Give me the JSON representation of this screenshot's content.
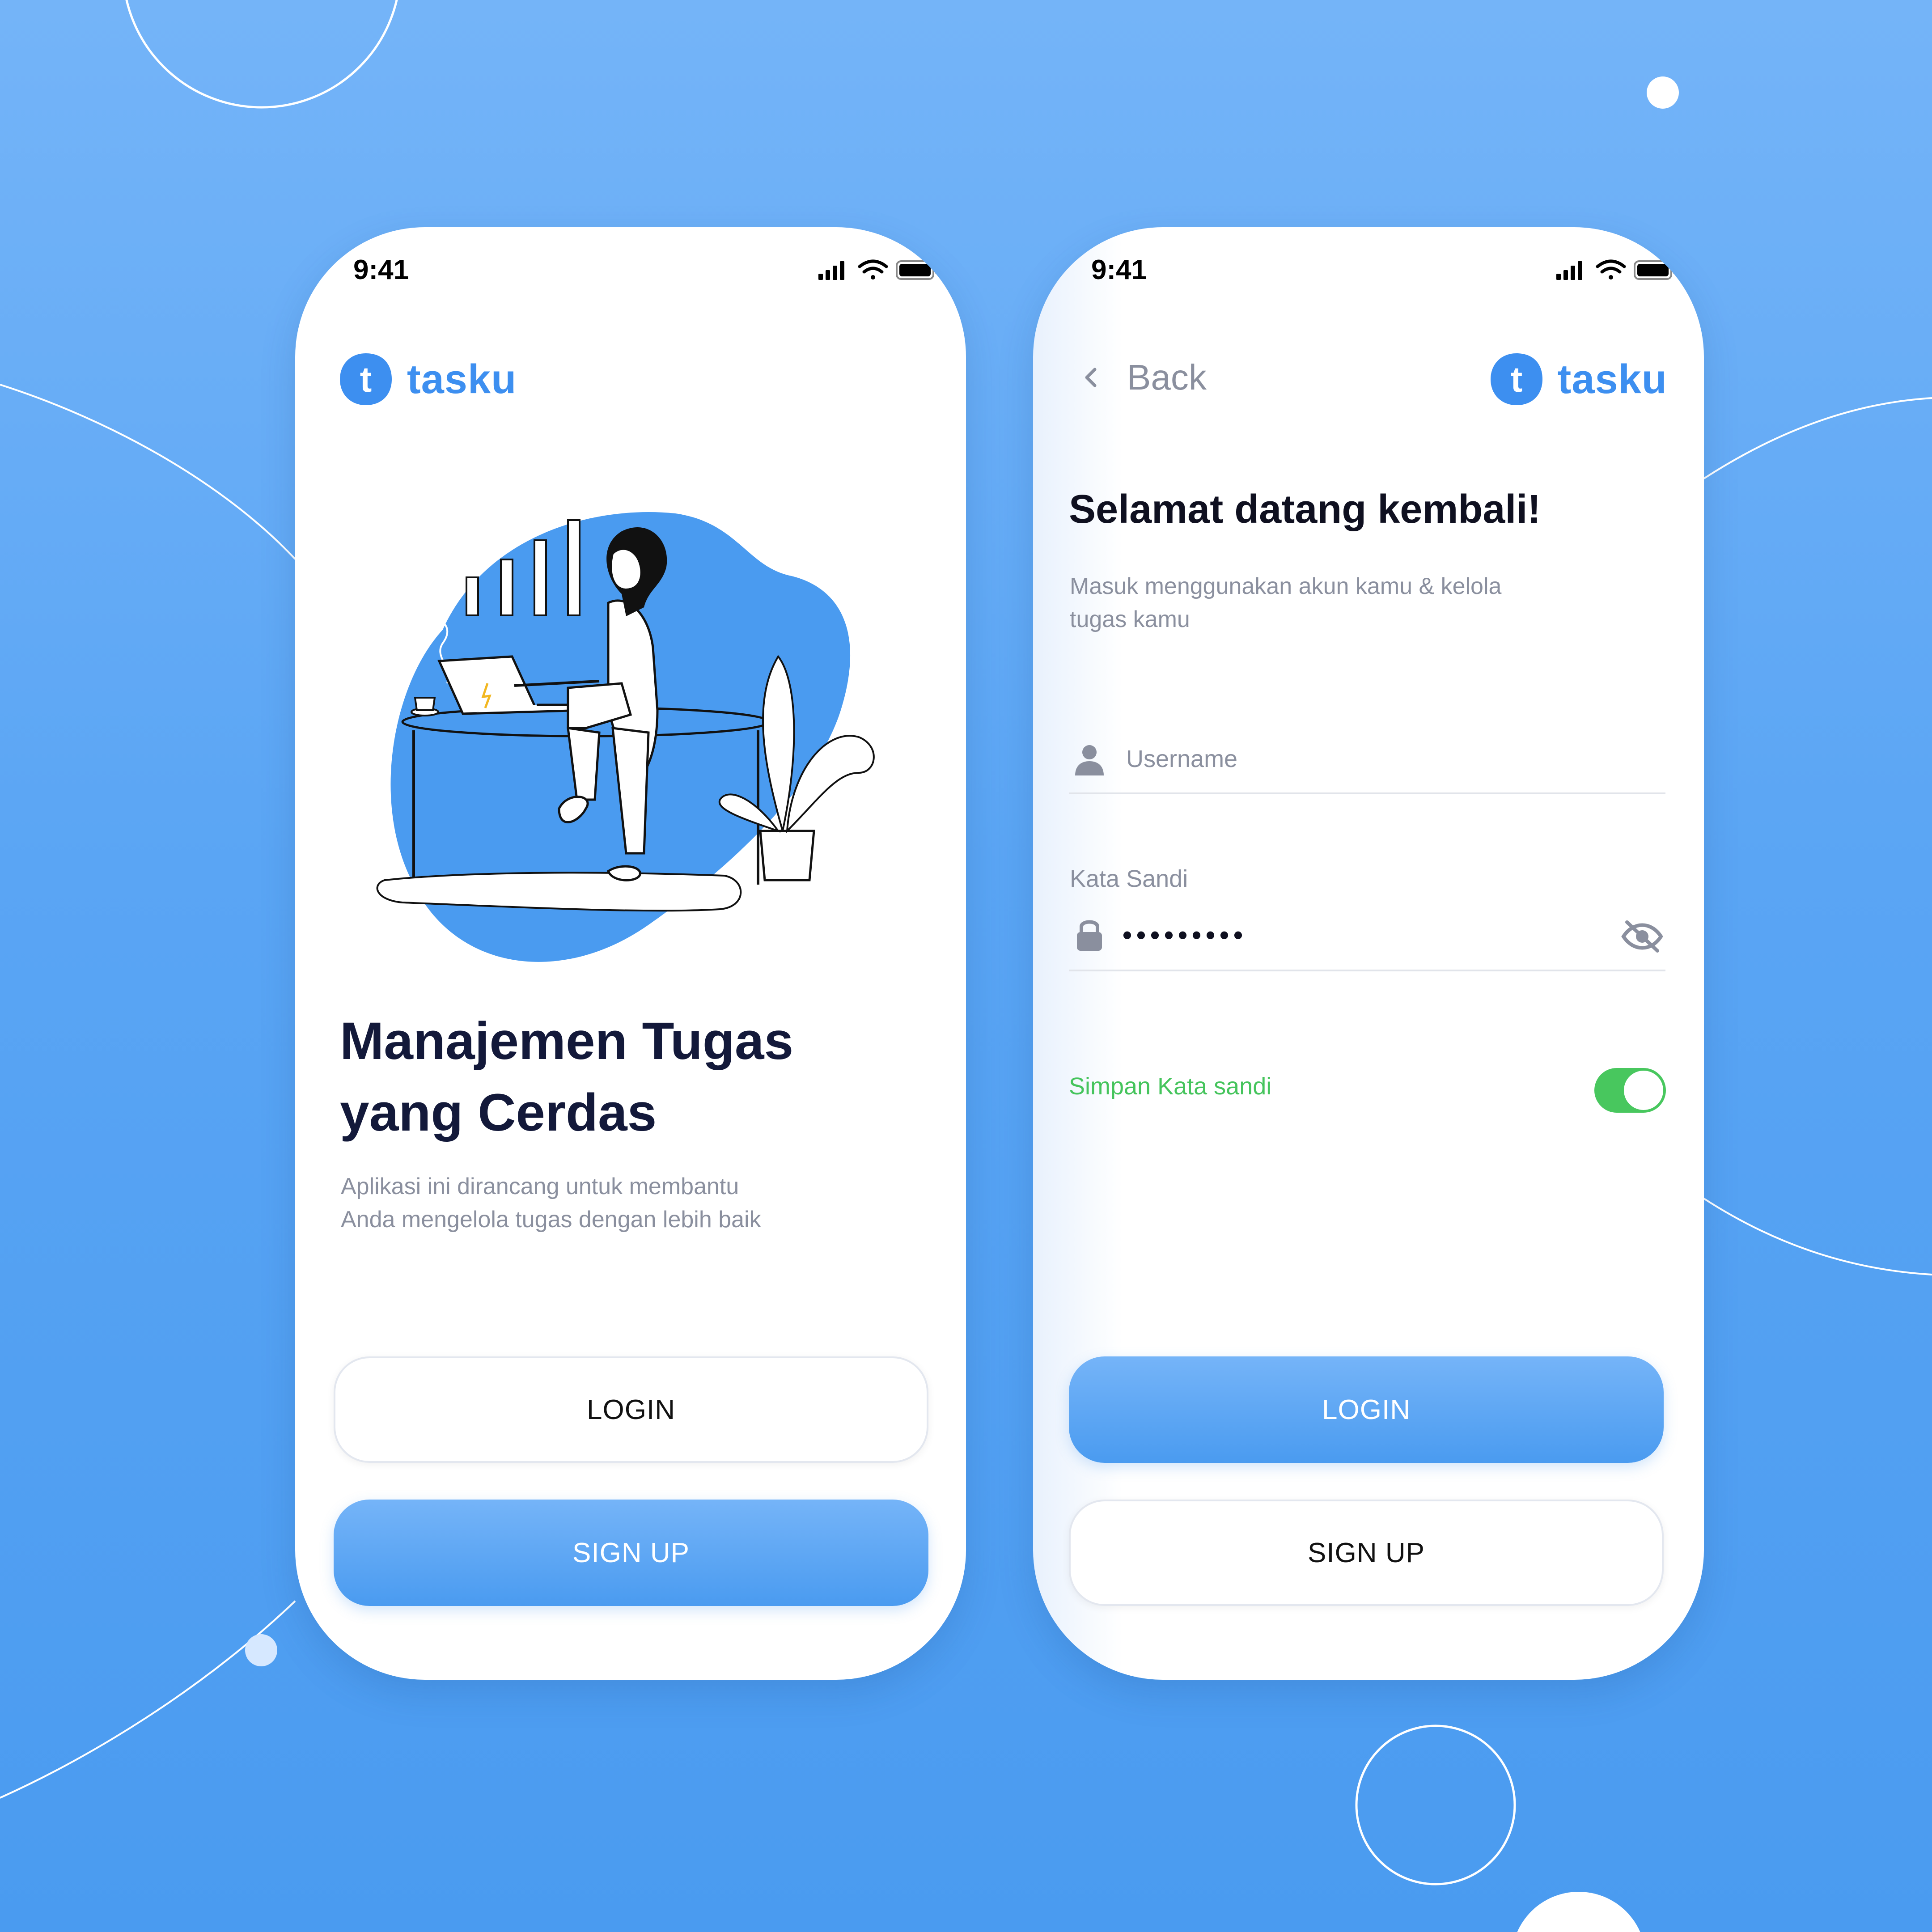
{
  "status_bar": {
    "time": "9:41"
  },
  "brand": {
    "name": "tasku",
    "mark_letter": "t",
    "color": "#3d8ff0"
  },
  "onboarding": {
    "title_line1": "Manajemen Tugas",
    "title_line2": "yang Cerdas",
    "description_line1": "Aplikasi ini dirancang untuk membantu",
    "description_line2": "Anda mengelola tugas dengan lebih baik",
    "login_label": "LOGIN",
    "signup_label": "SIGN UP",
    "illustration": "woman-working-at-laptop-illustration"
  },
  "login_screen": {
    "back_label": "Back",
    "heading": "Selamat datang kembali!",
    "subheading_line1": "Masuk menggunakan akun kamu &  kelola",
    "subheading_line2": "tugas kamu",
    "username_placeholder": "Username",
    "password_label": "Kata Sandi",
    "password_value": "•••••••••",
    "remember_label": "Simpan Kata sandi",
    "remember_enabled": true,
    "login_label": "LOGIN",
    "signup_label": "SIGN UP"
  },
  "colors": {
    "background_top": "#74b4f8",
    "background_bottom": "#4a9bf0",
    "primary": "#4a9bf0",
    "toggle_on": "#48c75e",
    "heading": "#13193a",
    "muted_text": "#8a8f9e"
  }
}
